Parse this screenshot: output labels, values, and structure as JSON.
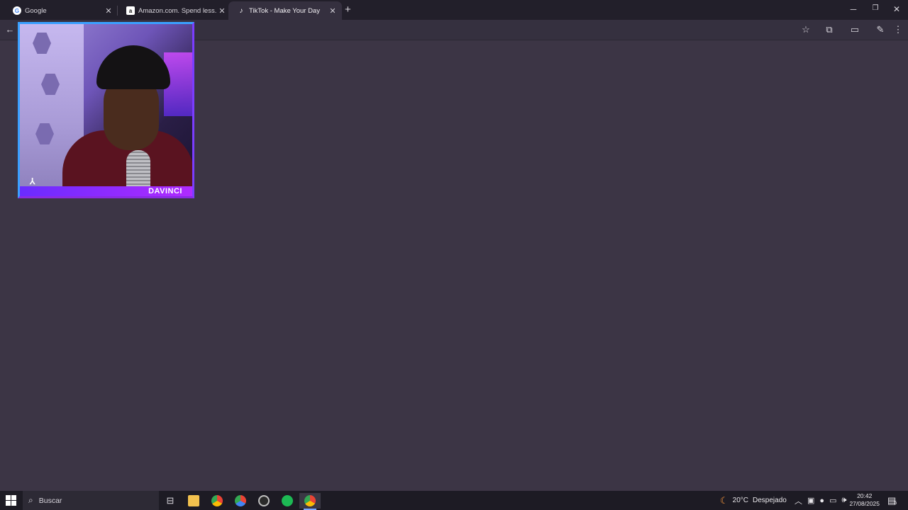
{
  "tabs": [
    {
      "title": "Google",
      "favicon": "google-icon",
      "active": false
    },
    {
      "title": "Amazon.com. Spend less. Smile more.",
      "favicon": "amazon-icon",
      "active": false
    },
    {
      "title": "TikTok - Make Your Day",
      "favicon": "tiktok-icon",
      "active": true
    }
  ],
  "pip": {
    "overlay_text": "DAVINCI"
  },
  "taskbar": {
    "search_placeholder": "Buscar",
    "weather_temp": "20°C",
    "weather_desc": "Despejado",
    "time": "20:42",
    "date": "27/08/2025",
    "notifications_count": "5"
  },
  "colors": {
    "accent": "#3aa0ff",
    "pip_purple": "#8a2be2",
    "spotify": "#1db954"
  }
}
